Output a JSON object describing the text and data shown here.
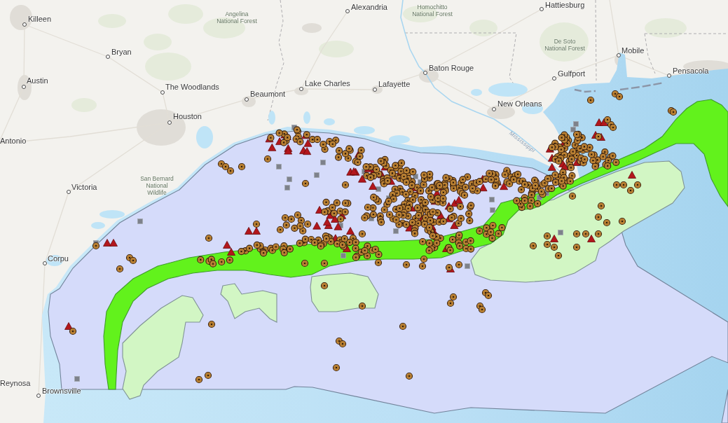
{
  "map": {
    "places": [
      {
        "name": "Killeen",
        "kind": "city"
      },
      {
        "name": "Angelina National Forest",
        "kind": "park"
      },
      {
        "name": "Alexandria",
        "kind": "city"
      },
      {
        "name": "Homochitto National Forest",
        "kind": "park"
      },
      {
        "name": "Hattiesburg",
        "kind": "city"
      },
      {
        "name": "Bryan",
        "kind": "city"
      },
      {
        "name": "De Soto National Forest",
        "kind": "park"
      },
      {
        "name": "Mobile",
        "kind": "city"
      },
      {
        "name": "Baton Rouge",
        "kind": "city"
      },
      {
        "name": "Gulfport",
        "kind": "city"
      },
      {
        "name": "Pensacola",
        "kind": "city"
      },
      {
        "name": "Austin",
        "kind": "city"
      },
      {
        "name": "The Woodlands",
        "kind": "city"
      },
      {
        "name": "Lake Charles",
        "kind": "city"
      },
      {
        "name": "Lafayette",
        "kind": "city"
      },
      {
        "name": "Beaumont",
        "kind": "city"
      },
      {
        "name": "New Orleans",
        "kind": "city"
      },
      {
        "name": "Houston",
        "kind": "city"
      },
      {
        "name": "Antonio",
        "kind": "city"
      },
      {
        "name": "Mississippi",
        "kind": "river"
      },
      {
        "name": "Victoria",
        "kind": "city"
      },
      {
        "name": "San Bernard National Wildlife",
        "kind": "park"
      },
      {
        "name": "Corpu",
        "kind": "city"
      },
      {
        "name": "Reynosa",
        "kind": "city"
      },
      {
        "name": "Brownsville",
        "kind": "city"
      }
    ]
  }
}
